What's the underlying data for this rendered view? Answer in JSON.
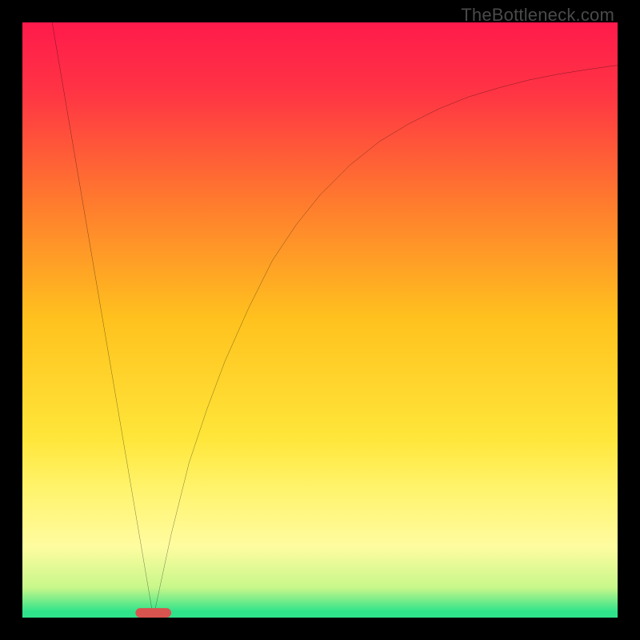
{
  "watermark": "TheBottleneck.com",
  "chart_data": {
    "type": "line",
    "title": "",
    "xlabel": "",
    "ylabel": "",
    "xlim": [
      0,
      100
    ],
    "ylim": [
      0,
      100
    ],
    "background_gradient": {
      "stops": [
        {
          "offset": 0.0,
          "color": "#ff1a4b"
        },
        {
          "offset": 0.12,
          "color": "#ff3544"
        },
        {
          "offset": 0.3,
          "color": "#ff7a2e"
        },
        {
          "offset": 0.5,
          "color": "#ffc21e"
        },
        {
          "offset": 0.7,
          "color": "#ffe63a"
        },
        {
          "offset": 0.78,
          "color": "#fff36a"
        },
        {
          "offset": 0.88,
          "color": "#fffca0"
        },
        {
          "offset": 0.95,
          "color": "#c7f78a"
        },
        {
          "offset": 0.99,
          "color": "#2fe38a"
        }
      ]
    },
    "series": [
      {
        "name": "left-branch",
        "segment": "line",
        "x": [
          5,
          22
        ],
        "y": [
          100,
          0
        ]
      },
      {
        "name": "right-branch",
        "segment": "curve",
        "x": [
          22,
          25,
          28,
          31,
          34,
          38,
          42,
          46,
          50,
          55,
          60,
          65,
          70,
          75,
          80,
          85,
          90,
          95,
          100
        ],
        "y": [
          0,
          14,
          26,
          35,
          43,
          52,
          60,
          66,
          71,
          76,
          80,
          83,
          85.5,
          87.5,
          89,
          90.3,
          91.3,
          92.1,
          92.8
        ]
      }
    ],
    "marker": {
      "name": "minimum-marker",
      "x": 22,
      "y": 0,
      "width": 6,
      "height": 1.6,
      "color": "#d9534f"
    }
  }
}
